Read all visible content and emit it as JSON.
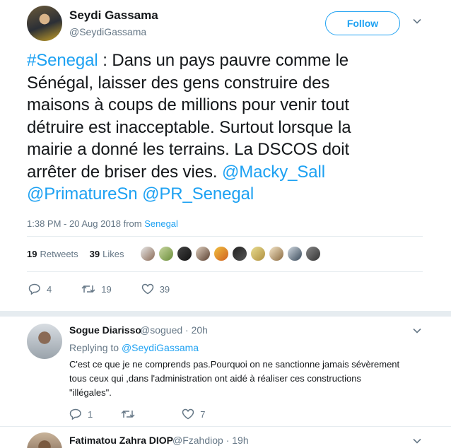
{
  "tweet": {
    "author_name": "Seydi Gassama",
    "author_handle": "@SeydiGassama",
    "follow_label": "Follow",
    "text_lines": [
      {
        "hashtag": "#Senegal",
        "text": " : Dans un pays pauvre comme le"
      },
      {
        "text": "Sénégal, laisser des gens construire des"
      },
      {
        "text": "maisons à coups de millions pour venir tout"
      },
      {
        "text": "détruire est inacceptable. Surtout lorsque la"
      },
      {
        "text": "mairie a donné les terrains. La DSCOS doit"
      },
      {
        "text": "arrêter de briser des vies. ",
        "mention": "@Macky_Sall"
      },
      {
        "mention": "@PrimatureSn",
        "mention2": "@PR_Senegal"
      }
    ],
    "timestamp": "1:38 PM - 20 Aug 2018 from ",
    "location": "Senegal",
    "retweets_count": "19",
    "retweets_label": "Retweets",
    "likes_count": "39",
    "likes_label": "Likes",
    "actions": {
      "reply_count": "4",
      "retweet_count": "19",
      "like_count": "39"
    },
    "colors": {
      "accent": "#1da1f2",
      "secondary_text": "#657786",
      "divider": "#e6ecf0"
    }
  },
  "replies": [
    {
      "name": "Sogue Diarisso",
      "handle_time": "@sogued · 20h",
      "replying_prefix": "Replying to ",
      "replying_to": "@SeydiGassama",
      "text_lines": [
        "C'est ce que je ne comprends pas.Pourquoi on ne sanctionne jamais sévèrement",
        "tous ceux qui ,dans l'administration ont aidé à réaliser ces constructions",
        "\"illégales\"."
      ],
      "reply_count": "1",
      "retweet_count": "",
      "like_count": "7"
    },
    {
      "name": "Fatimatou Zahra DIOP",
      "handle_time": "@Fzahdiop · 19h"
    }
  ],
  "icons": [
    "chevron-down-icon",
    "reply-icon",
    "retweet-icon",
    "like-icon"
  ]
}
